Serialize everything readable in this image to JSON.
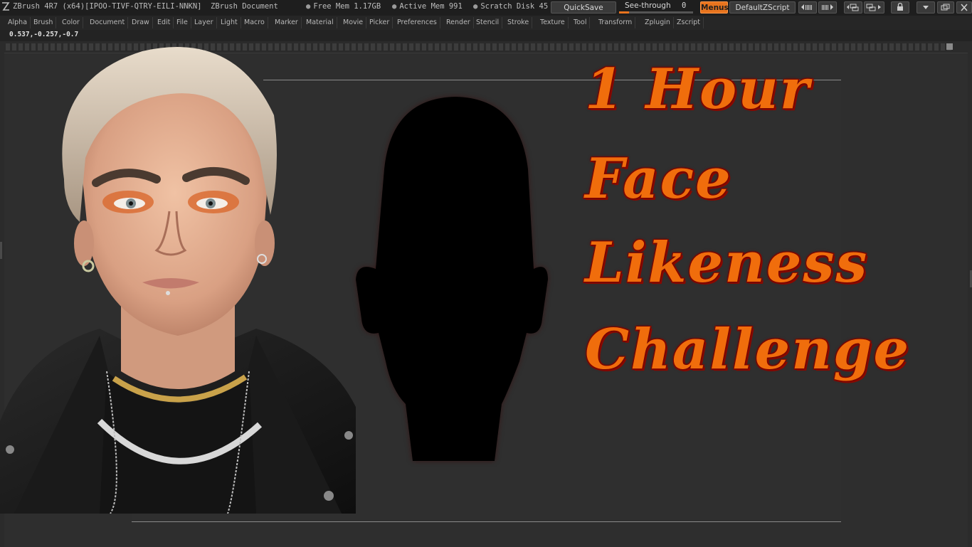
{
  "titlebar": {
    "app_title": "ZBrush 4R7 (x64)[IPOO-TIVF-QTRY-EILI-NNKN]",
    "doc_title": "ZBrush Document",
    "free_mem": "Free Mem 1.17GB",
    "active_mem": "Active Mem 991",
    "scratch_disk": "Scratch Disk 45",
    "quicksave_label": "QuickSave",
    "see_through_label": "See-through",
    "see_through_value": "0",
    "menus_label": "Menus",
    "script_label": "DefaultZScript"
  },
  "menubar": {
    "items": [
      "Alpha",
      "Brush",
      "Color",
      "Document",
      "Draw",
      "Edit",
      "File",
      "Layer",
      "Light",
      "Macro",
      "Marker",
      "Material",
      "Movie",
      "Picker",
      "Preferences",
      "Render",
      "Stencil",
      "Stroke",
      "Texture",
      "Tool",
      "Transform",
      "Zplugin",
      "Zscript"
    ]
  },
  "coords": "0.537,-0.257,-0.7",
  "headline": {
    "line1": "1 Hour",
    "line2": "Face",
    "line3": "Likeness",
    "line4": "Challenge"
  },
  "colors": {
    "accent": "#e8741e",
    "headline_fill": "#f06d0c",
    "headline_outline": "#8a0a00"
  },
  "icons": {
    "app": "zbrush-z-icon",
    "window_controls": [
      "minimize-icon",
      "restore-icon",
      "close-icon"
    ]
  }
}
